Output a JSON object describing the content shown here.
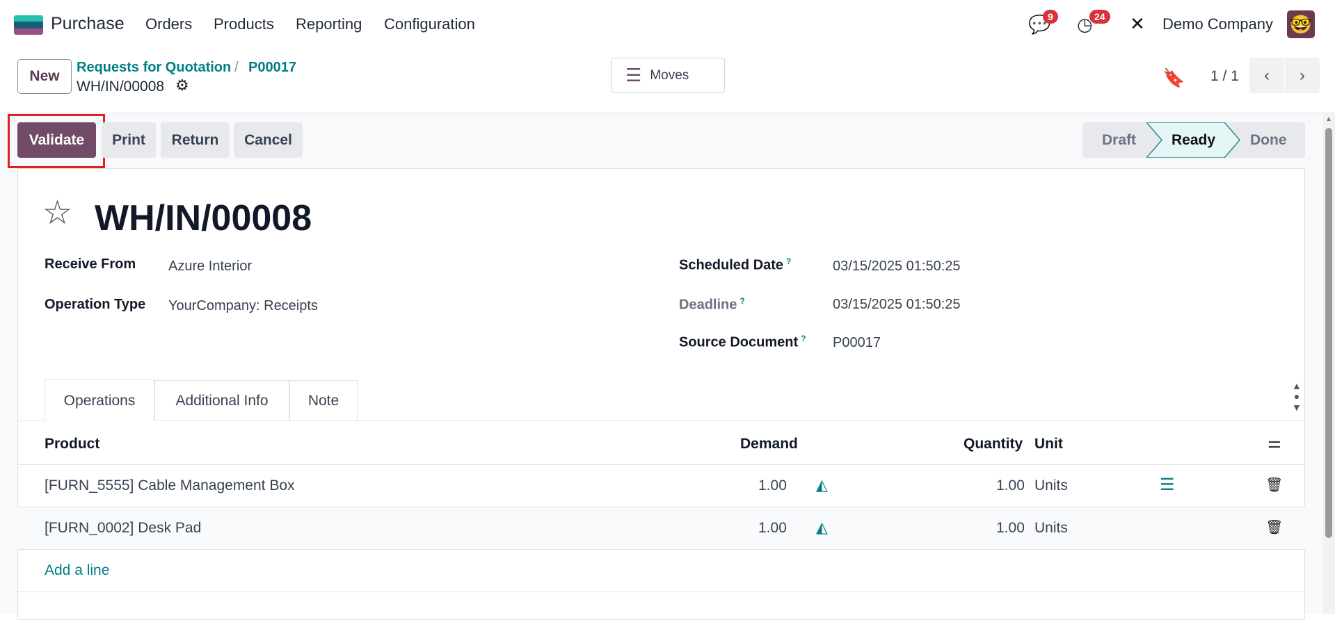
{
  "nav": {
    "app": "Purchase",
    "items": [
      "Orders",
      "Products",
      "Reporting",
      "Configuration"
    ],
    "messages_count": "9",
    "activities_count": "24",
    "company": "Demo Company"
  },
  "control": {
    "new_label": "New",
    "breadcrumb": [
      "Requests for Quotation",
      "P00017"
    ],
    "current": "WH/IN/00008",
    "moves_label": "Moves",
    "pager": "1 / 1"
  },
  "actions": {
    "validate": "Validate",
    "print": "Print",
    "return": "Return",
    "cancel": "Cancel"
  },
  "status": {
    "steps": [
      "Draft",
      "Ready",
      "Done"
    ],
    "active": "Ready"
  },
  "record": {
    "title": "WH/IN/00008",
    "left_fields": [
      {
        "label": "Receive From",
        "value": "Azure Interior"
      },
      {
        "label": "Operation Type",
        "value": "YourCompany: Receipts"
      }
    ],
    "right_fields": [
      {
        "label": "Scheduled Date",
        "value": "03/15/2025 01:50:25",
        "help": "?"
      },
      {
        "label": "Deadline",
        "value": "03/15/2025 01:50:25",
        "help": "?"
      },
      {
        "label": "Source Document",
        "value": "P00017",
        "help": "?"
      }
    ]
  },
  "tabs": [
    "Operations",
    "Additional Info",
    "Note"
  ],
  "table": {
    "headers": {
      "product": "Product",
      "demand": "Demand",
      "quantity": "Quantity",
      "unit": "Unit"
    },
    "rows": [
      {
        "product": "[FURN_5555] Cable Management Box",
        "demand": "1.00",
        "quantity": "1.00",
        "unit": "Units"
      },
      {
        "product": "[FURN_0002] Desk Pad",
        "demand": "1.00",
        "quantity": "1.00",
        "unit": "Units"
      }
    ],
    "add_line": "Add a line"
  },
  "colors": {
    "brand": "#714b67",
    "link": "#017e84",
    "badge": "#d9323b",
    "highlight": "#e02020"
  }
}
